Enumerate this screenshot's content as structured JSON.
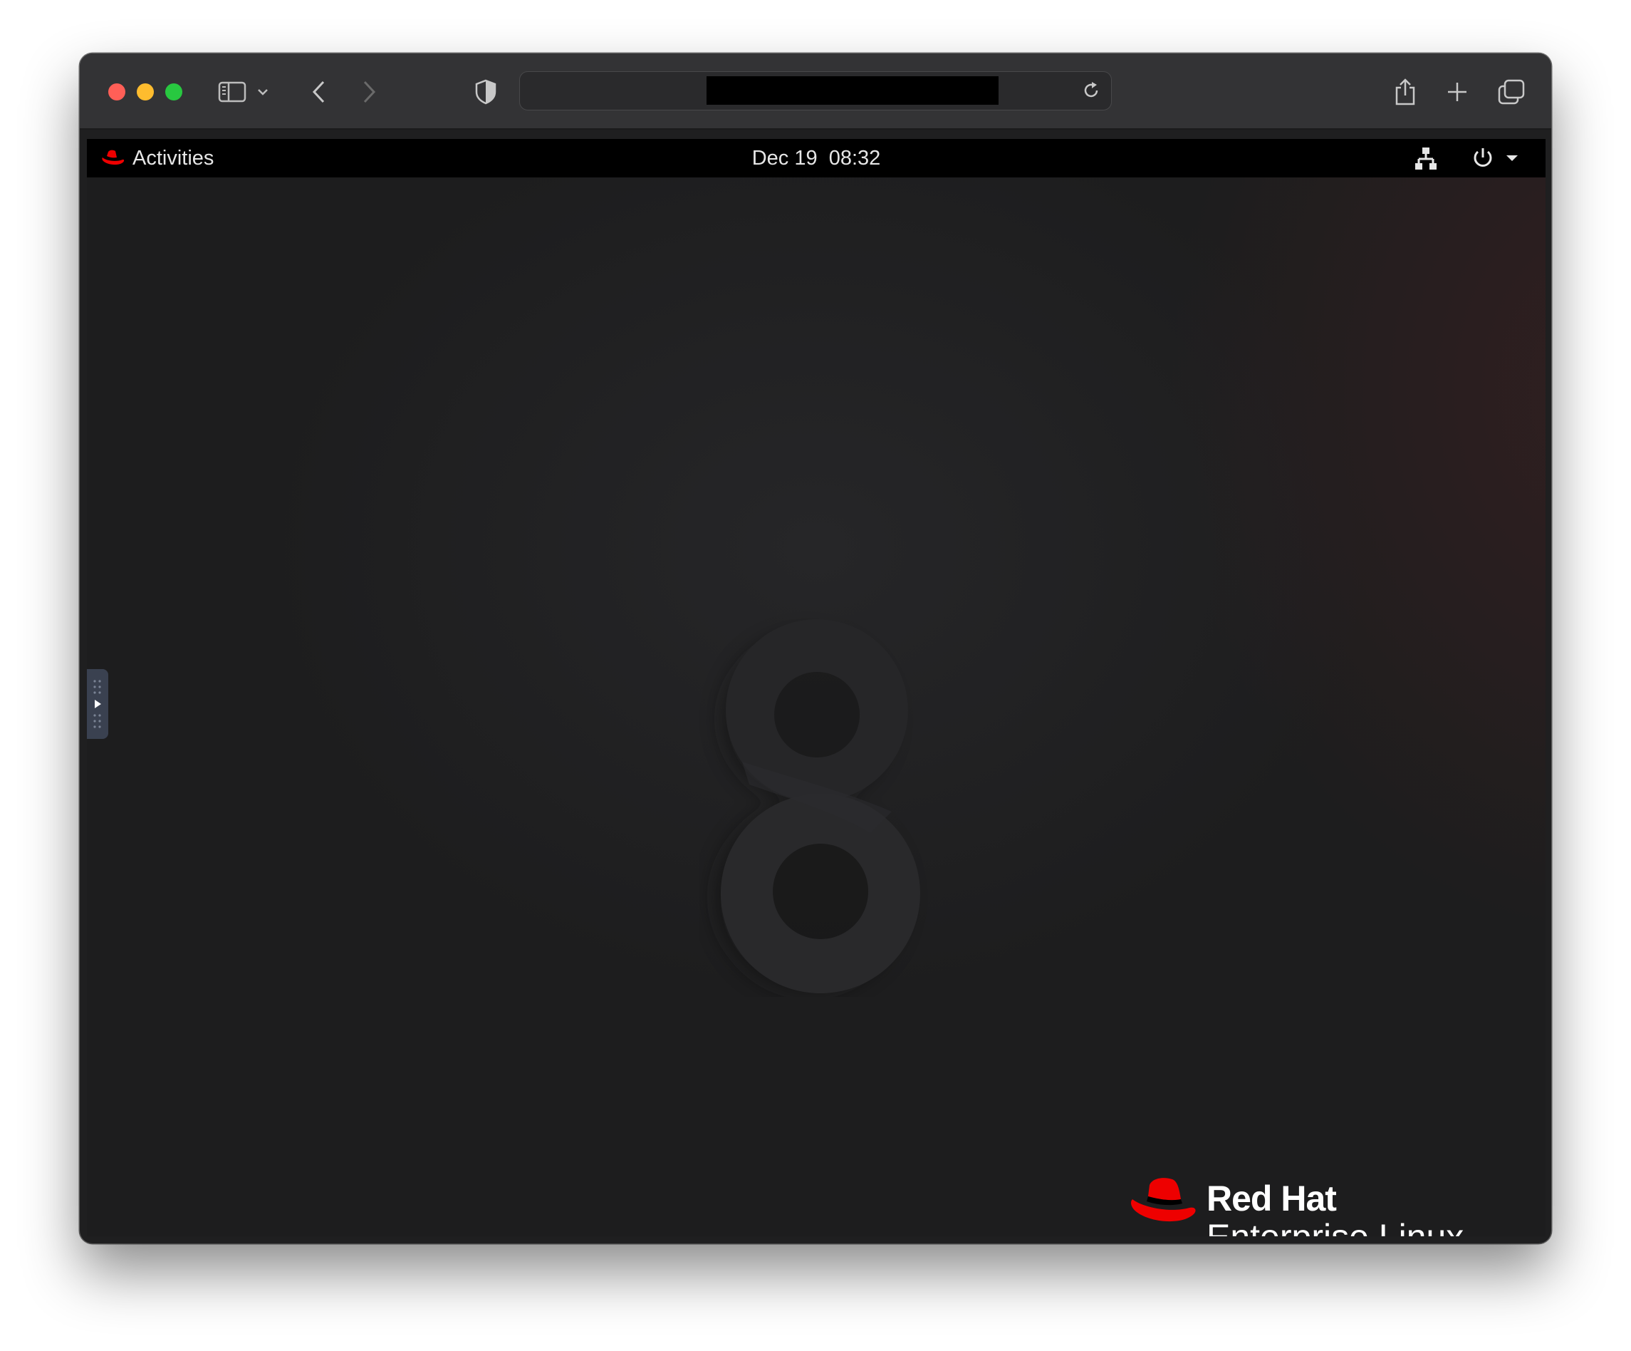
{
  "browser": {
    "url_redacted": true
  },
  "gnome": {
    "activities_label": "Activities",
    "datetime": "Dec 19  08:32",
    "brand_name": "Red Hat",
    "brand_product": "Enterprise Linux",
    "accent_color": "#ee0000"
  },
  "icons": [
    "sidebar-icon",
    "chevron-down-icon",
    "back-icon",
    "forward-icon",
    "privacy-shield-icon",
    "reload-icon",
    "share-icon",
    "new-tab-icon",
    "tab-overview-icon",
    "redhat-logo-icon",
    "network-icon",
    "power-icon",
    "dropdown-arrow-icon"
  ]
}
